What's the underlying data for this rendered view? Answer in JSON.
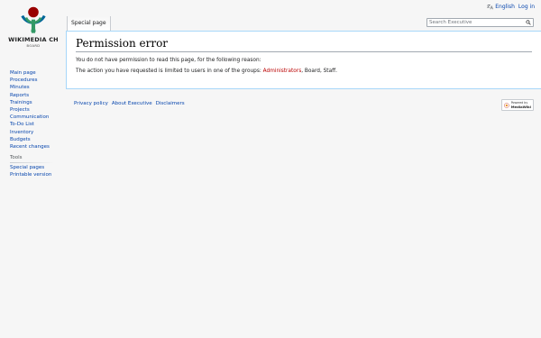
{
  "personal": {
    "language": "English",
    "login": "Log in"
  },
  "logo": {
    "title": "WIKIMEDIA CH",
    "subtitle": "BOARD"
  },
  "tab": {
    "label": "Special page"
  },
  "search": {
    "placeholder": "Search Executive"
  },
  "content": {
    "heading": "Permission error",
    "line1": "You do not have permission to read this page, for the following reason:",
    "line2_prefix": "The action you have requested is limited to users in one of the groups: ",
    "group_link": "Administrators",
    "line2_suffix": ", Board, Staff."
  },
  "sidebar": {
    "items": [
      "Main page",
      "Procedures",
      "Minutes",
      "Reports",
      "Trainings",
      "Projects",
      "Communication",
      "To-Do List",
      "Inventory",
      "Budgets",
      "Recent changes"
    ],
    "tools_heading": "Tools",
    "tools_items": [
      "Special pages",
      "Printable version"
    ]
  },
  "footer": {
    "links": [
      "Privacy policy",
      "About Executive",
      "Disclaimers"
    ]
  },
  "powered": {
    "line1": "Powered by",
    "line2": "MediaWiki"
  },
  "colors": {
    "link": "#0645ad",
    "redlink": "#ba0000",
    "border": "#a7d7f9"
  }
}
